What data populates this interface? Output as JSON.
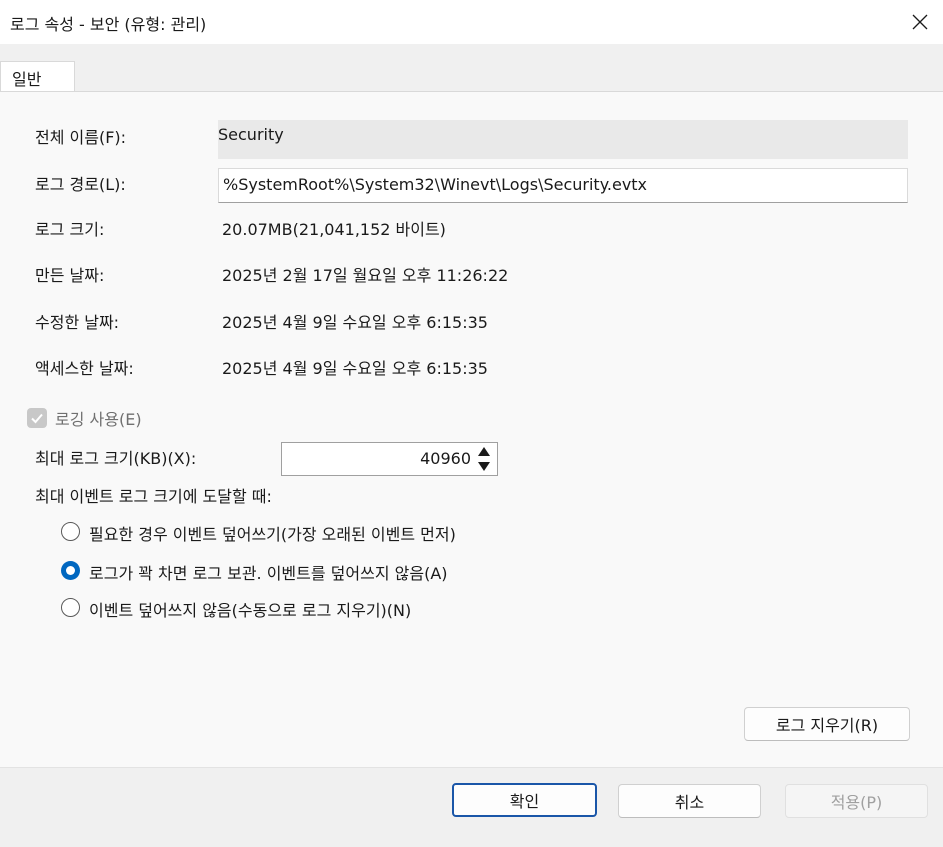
{
  "window": {
    "title": "로그 속성 - 보안 (유형: 관리)"
  },
  "tabs": [
    {
      "label": "일반",
      "selected": true
    }
  ],
  "general": {
    "full_name_label": "전체 이름(F):",
    "full_name_value": "Security",
    "log_path_label": "로그 경로(L):",
    "log_path_value": "%SystemRoot%\\System32\\Winevt\\Logs\\Security.evtx",
    "log_size_label": "로그 크기:",
    "log_size_value": "20.07MB(21,041,152 바이트)",
    "created_label": "만든 날짜:",
    "created_value": "2025년 2월 17일 월요일 오후 11:26:22",
    "modified_label": "수정한 날짜:",
    "modified_value": "2025년 4월 9일 수요일 오후 6:15:35",
    "accessed_label": "액세스한 날짜:",
    "accessed_value": "2025년 4월 9일 수요일 오후 6:15:35",
    "enable_logging_label": "로깅 사용(E)",
    "enable_logging_checked": true,
    "max_size_label": "최대 로그 크기(KB)(X):",
    "max_size_value": "40960",
    "when_max_label": "최대 이벤트 로그 크기에 도달할 때:",
    "options": [
      {
        "label": "필요한 경우 이벤트 덮어쓰기(가장 오래된 이벤트 먼저)",
        "checked": false
      },
      {
        "label": "로그가 꽉 차면 로그 보관. 이벤트를 덮어쓰지 않음(A)",
        "checked": true
      },
      {
        "label": "이벤트 덮어쓰지 않음(수동으로 로그 지우기)(N)",
        "checked": false
      }
    ],
    "clear_log_label": "로그 지우기(R)"
  },
  "footer": {
    "ok_label": "확인",
    "cancel_label": "취소",
    "apply_label": "적용(P)"
  },
  "icons": {
    "close": "close-icon",
    "check": "check-icon",
    "spin_up": "arrow-up-icon",
    "spin_down": "arrow-down-icon"
  },
  "colors": {
    "accent": "#0067c0",
    "primary_border": "#1a56a8",
    "disabled_text": "#a0a0a0"
  }
}
